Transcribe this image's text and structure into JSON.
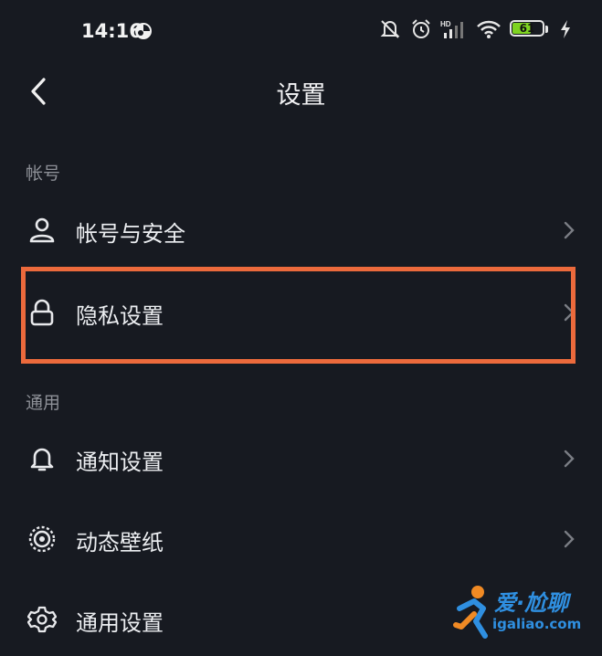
{
  "status": {
    "time": "14:16",
    "battery_level": "61",
    "battery_fraction": 0.61,
    "network_badge": "HD",
    "colors": {
      "battery_fill": "#7ed321"
    }
  },
  "header": {
    "title": "设置",
    "back_icon": "chevron-left-icon"
  },
  "sections": [
    {
      "label": "帐号",
      "items": [
        {
          "label": "帐号与安全",
          "icon": "user-icon"
        },
        {
          "label": "隐私设置",
          "icon": "lock-icon"
        }
      ]
    },
    {
      "label": "通用",
      "items": [
        {
          "label": "通知设置",
          "icon": "bell-icon"
        },
        {
          "label": "动态壁纸",
          "icon": "wallpaper-icon"
        },
        {
          "label": "通用设置",
          "icon": "gear-icon"
        }
      ]
    }
  ],
  "highlight_color": "#ec6a3c",
  "watermark": {
    "brand": "爱·尬聊",
    "url": "igaliao.com"
  }
}
